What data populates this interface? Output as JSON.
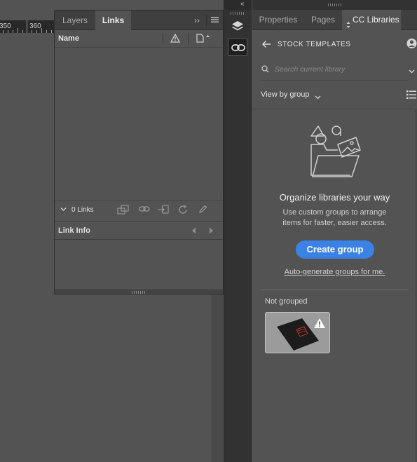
{
  "ruler": {
    "mark_a": "350",
    "mark_b": "360"
  },
  "links_panel": {
    "tabs": [
      {
        "label": "Layers"
      },
      {
        "label": "Links"
      }
    ],
    "columns": {
      "name": "Name"
    },
    "links_count": "0 Links",
    "link_info_title": "Link Info"
  },
  "side_icons": [
    "layers-icon",
    "links-icon"
  ],
  "cc_libraries": {
    "tabs": [
      {
        "label": "Properties"
      },
      {
        "label": "Pages"
      },
      {
        "label": "CC Libraries"
      }
    ],
    "library_name": "STOCK TEMPLATES",
    "search_placeholder": "Search current library",
    "view_by": "View by group",
    "empty_title": "Organize libraries your way",
    "empty_desc_line1": "Use custom groups to arrange",
    "empty_desc_line2": "items for faster, easier access.",
    "create_group": "Create group",
    "auto_generate": "Auto-generate groups for me.",
    "not_grouped": "Not grouped"
  },
  "colors": {
    "accent": "#3b82e6",
    "panel_bg": "#535353",
    "tab_bar_bg": "#3f3f3f",
    "dark_strip": "#323232"
  }
}
